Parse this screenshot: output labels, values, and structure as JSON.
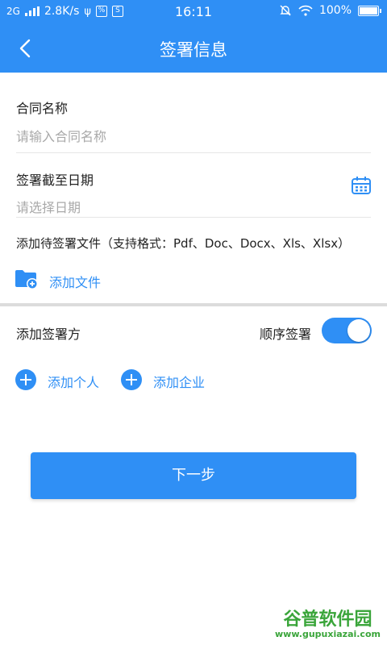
{
  "status_bar": {
    "network": "2G",
    "speed": "2.8K/s",
    "time": "16:11",
    "battery": "100%"
  },
  "nav": {
    "title": "签署信息"
  },
  "form": {
    "contract_name_label": "合同名称",
    "contract_name_placeholder": "请输入合同名称",
    "deadline_label": "签署截至日期",
    "deadline_placeholder": "请选择日期",
    "files_label": "添加待签署文件（支持格式：Pdf、Doc、Docx、Xls、Xlsx）",
    "add_file": "添加文件"
  },
  "signers": {
    "label": "添加签署方",
    "sequential_label": "顺序签署",
    "sequential_on": true,
    "add_person": "添加个人",
    "add_company": "添加企业"
  },
  "next_button": "下一步",
  "watermark": {
    "name": "谷普软件园",
    "url": "www.gupuxiazai.com"
  },
  "colors": {
    "primary": "#2f8ff5",
    "watermark": "#3aa53a"
  },
  "icons": {
    "back": "chevron-left-icon",
    "calendar": "calendar-icon",
    "folder_add": "folder-add-icon",
    "plus": "plus-circle-icon"
  }
}
